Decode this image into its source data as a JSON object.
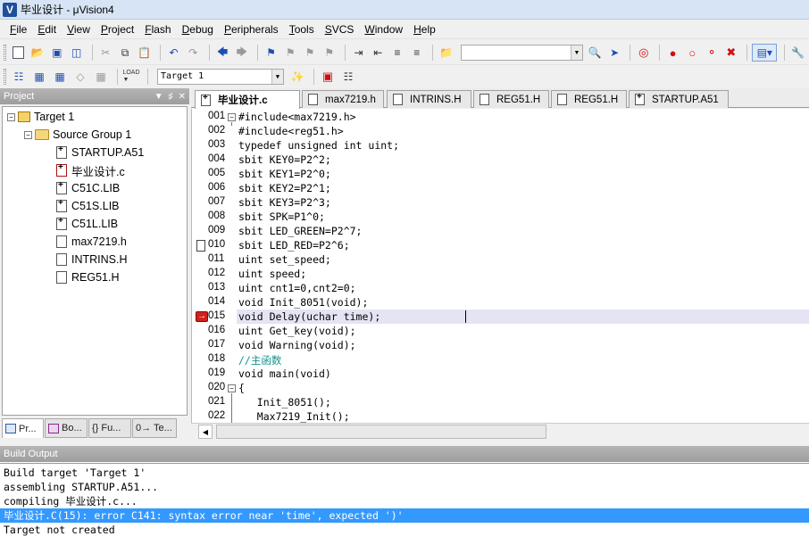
{
  "window": {
    "title": "毕业设计 - μVision4",
    "icon": "uvision-icon"
  },
  "menu": [
    "File",
    "Edit",
    "View",
    "Project",
    "Flash",
    "Debug",
    "Peripherals",
    "Tools",
    "SVCS",
    "Window",
    "Help"
  ],
  "toolbar": {
    "find_value": "",
    "target_value": "Target 1"
  },
  "project": {
    "title": "Project",
    "tree": {
      "target": "Target 1",
      "group": "Source Group 1",
      "files": [
        "STARTUP.A51",
        "毕业设计.c",
        "C51C.LIB",
        "C51S.LIB",
        "C51L.LIB",
        "max7219.h",
        "INTRINS.H",
        "REG51.H"
      ]
    },
    "tabs": [
      "Pr...",
      "Bo...",
      "{} Fu...",
      "0→ Te..."
    ]
  },
  "editor": {
    "tabs": [
      "毕业设计.c",
      "max7219.h",
      "INTRINS.H",
      "REG51.H",
      "REG51.H",
      "STARTUP.A51"
    ],
    "active_tab": 0,
    "lines": [
      {
        "n": "001",
        "t": "#include<max7219.h>"
      },
      {
        "n": "002",
        "t": "#include<reg51.h>"
      },
      {
        "n": "003",
        "t": "typedef unsigned int uint;"
      },
      {
        "n": "004",
        "t": "sbit KEY0=P2^2;"
      },
      {
        "n": "005",
        "t": "sbit KEY1=P2^0;"
      },
      {
        "n": "006",
        "t": "sbit KEY2=P2^1;"
      },
      {
        "n": "007",
        "t": "sbit KEY3=P2^3;"
      },
      {
        "n": "008",
        "t": "sbit SPK=P1^0;"
      },
      {
        "n": "009",
        "t": "sbit LED_GREEN=P2^7;"
      },
      {
        "n": "010",
        "t": "sbit LED_RED=P2^6;"
      },
      {
        "n": "011",
        "t": "uint set_speed;"
      },
      {
        "n": "012",
        "t": "uint speed;"
      },
      {
        "n": "013",
        "t": "uint cnt1=0,cnt2=0;"
      },
      {
        "n": "014",
        "t": "void Init_8051(void);"
      },
      {
        "n": "015",
        "t": "void Delay(uchar time);"
      },
      {
        "n": "016",
        "t": "uint Get_key(void);"
      },
      {
        "n": "017",
        "t": "void Warning(void);"
      },
      {
        "n": "018",
        "t": "//主函数"
      },
      {
        "n": "019",
        "t": "void main(void)"
      },
      {
        "n": "020",
        "t": "{"
      },
      {
        "n": "021",
        "t": "   Init_8051();"
      },
      {
        "n": "022",
        "t": "   Max7219_Init();"
      }
    ]
  },
  "output": {
    "title": "Build Output",
    "lines": [
      "Build target 'Target 1'",
      "assembling STARTUP.A51...",
      "compiling 毕业设计.c...",
      "毕业设计.C(15): error C141: syntax error near 'time', expected ')'",
      "Target not created"
    ]
  },
  "colors": {
    "selection": "#3399ff",
    "comment": "#14928a",
    "current_line": "#e4e4f4",
    "breakpoint": "#d01010"
  }
}
